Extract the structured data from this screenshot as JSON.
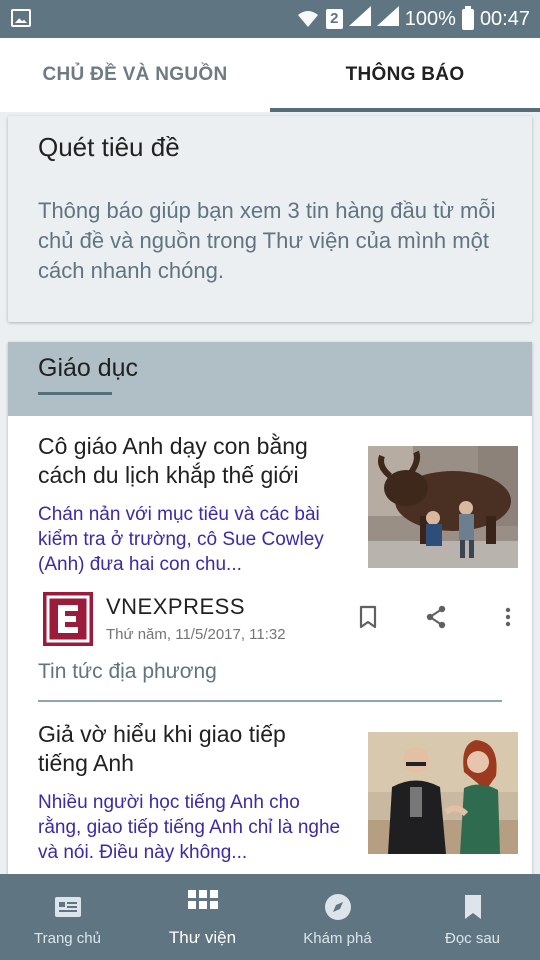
{
  "status_bar": {
    "sim_slot": "2",
    "battery": "100%",
    "time": "00:47"
  },
  "tabs": [
    {
      "label": "CHỦ ĐỀ VÀ NGUỒN",
      "selected": false
    },
    {
      "label": "THÔNG BÁO",
      "selected": true
    }
  ],
  "intro_card": {
    "title": "Quét tiêu đề",
    "description": "Thông báo giúp bạn xem 3 tin hàng đầu từ mỗi chủ đề và nguồn trong Thư viện của mình một cách nhanh chóng."
  },
  "section": {
    "title": "Giáo dục"
  },
  "articles": [
    {
      "headline": "Cô giáo Anh dạy con bằng cách du lịch khắp thế giới",
      "snippet": "Chán nản với mục tiêu và các bài kiểm tra ở trường, cô Sue Cowley (Anh) đưa hai con chu...",
      "thumbnail_icon": "bull-statue-photo",
      "source": "VNEXPRESS",
      "source_logo_letter": "E",
      "timestamp": "Thứ năm, 11/5/2017, 11:32",
      "category": "Tin tức địa phương"
    },
    {
      "headline": "Giả vờ hiểu khi giao tiếp tiếng Anh",
      "snippet": "Nhiều người học tiếng Anh cho rằng, giao tiếp tiếng Anh chỉ là nghe và nói. Điều này không...",
      "thumbnail_icon": "couple-talking-photo"
    }
  ],
  "bottom_nav": [
    {
      "label": "Trang chủ",
      "icon": "home-card-icon",
      "active": false
    },
    {
      "label": "Thư viện",
      "icon": "grid-icon",
      "active": true
    },
    {
      "label": "Khám phá",
      "icon": "compass-icon",
      "active": false
    },
    {
      "label": "Đọc sau",
      "icon": "bookmark-icon",
      "active": false
    }
  ],
  "colors": {
    "status_bar": "#5f7582",
    "accent": "#546e7a",
    "section_header": "#b0bec5",
    "snippet": "#3e2aa5",
    "source_logo": "#9b1b3a"
  }
}
